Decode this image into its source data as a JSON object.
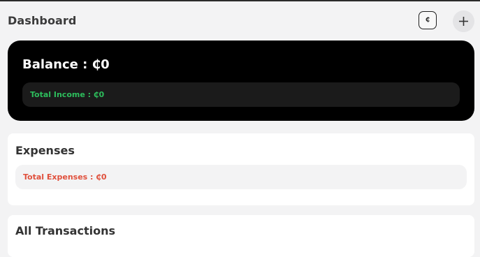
{
  "header": {
    "title": "Dashboard",
    "currency_button_label": "₵",
    "add_button_icon": "plus-icon"
  },
  "balance": {
    "title": "Balance : ₵0",
    "total_income": "Total Income : ₵0"
  },
  "expenses": {
    "title": "Expenses",
    "total_expenses": "Total Expenses : ₵0"
  },
  "transactions": {
    "title": "All Transactions"
  },
  "colors": {
    "income": "#2dbd5c",
    "expense": "#e0503c",
    "balance_card": "#000000",
    "page_background": "#f3f3f4"
  }
}
